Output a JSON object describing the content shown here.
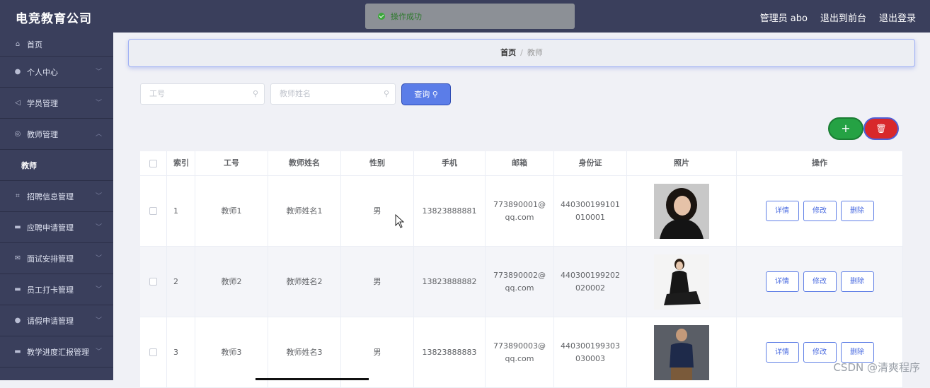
{
  "brand": "电竞教育公司",
  "toast": "操作成功",
  "top_right": {
    "admin": "管理员 abo",
    "front": "退出到前台",
    "logout": "退出登录"
  },
  "sidebar": {
    "items": [
      {
        "label": "首页",
        "icon": "home-icon"
      },
      {
        "label": "个人中心",
        "icon": "user-icon"
      },
      {
        "label": "学员管理",
        "icon": "send-icon"
      },
      {
        "label": "教师管理",
        "icon": "globe-icon"
      },
      {
        "label": "教师",
        "icon": ""
      },
      {
        "label": "招聘信息管理",
        "icon": "crop-icon"
      },
      {
        "label": "应聘申请管理",
        "icon": "doc-icon"
      },
      {
        "label": "面试安排管理",
        "icon": "mail-icon"
      },
      {
        "label": "员工打卡管理",
        "icon": "doc-icon"
      },
      {
        "label": "请假申请管理",
        "icon": "user-icon"
      },
      {
        "label": "教学进度汇报管理",
        "icon": "doc-icon"
      }
    ]
  },
  "breadcrumb": {
    "home": "首页",
    "sep": "/",
    "current": "教师"
  },
  "search": {
    "no_placeholder": "工号",
    "name_placeholder": "教师姓名",
    "button": "查询"
  },
  "actions": {
    "add": "+",
    "delete": "🗑"
  },
  "table": {
    "headers": [
      "索引",
      "工号",
      "教师姓名",
      "性别",
      "手机",
      "邮箱",
      "身份证",
      "照片",
      "操作"
    ],
    "rows": [
      {
        "idx": "1",
        "no": "教师1",
        "name": "教师姓名1",
        "sex": "男",
        "phone": "13823888881",
        "mail": "773890001@qq.com",
        "id": "440300199101010001"
      },
      {
        "idx": "2",
        "no": "教师2",
        "name": "教师姓名2",
        "sex": "男",
        "phone": "13823888882",
        "mail": "773890002@qq.com",
        "id": "440300199202020002"
      },
      {
        "idx": "3",
        "no": "教师3",
        "name": "教师姓名3",
        "sex": "男",
        "phone": "13823888883",
        "mail": "773890003@qq.com",
        "id": "440300199303030003"
      }
    ],
    "op": {
      "detail": "详情",
      "edit": "修改",
      "remove": "删除"
    }
  },
  "watermark": "CSDN @清爽程序",
  "colors": {
    "sidebar": "#3a3f5c",
    "primary": "#5b7de8",
    "add": "#25a244",
    "delete": "#d8282b"
  }
}
